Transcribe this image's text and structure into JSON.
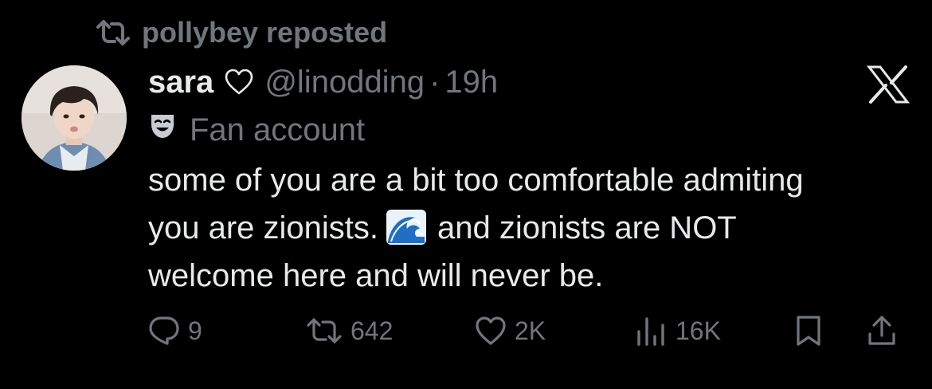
{
  "repost": {
    "text": "pollybey reposted",
    "icon": "repost-icon"
  },
  "author": {
    "display_name": "sara",
    "badge_icon": "heart-outline-icon",
    "handle": "@linodding",
    "separator": "·",
    "time": "19h"
  },
  "app_logo": "x-logo-icon",
  "label": {
    "icon": "theater-mask-icon",
    "text": "Fan account"
  },
  "tweet": {
    "line1": "some of you are a bit too comfortable admiting",
    "line2_before": "you are zionists.",
    "line2_emoji": "water-wave-emoji",
    "line2_after": "and zionists are NOT",
    "line3": "welcome here and will never be."
  },
  "actions": {
    "replies": "9",
    "reposts": "642",
    "likes": "2K",
    "views": "16K"
  },
  "colors": {
    "background": "#000000",
    "primary_text": "#e7e9ea",
    "secondary_text": "#71767b"
  }
}
